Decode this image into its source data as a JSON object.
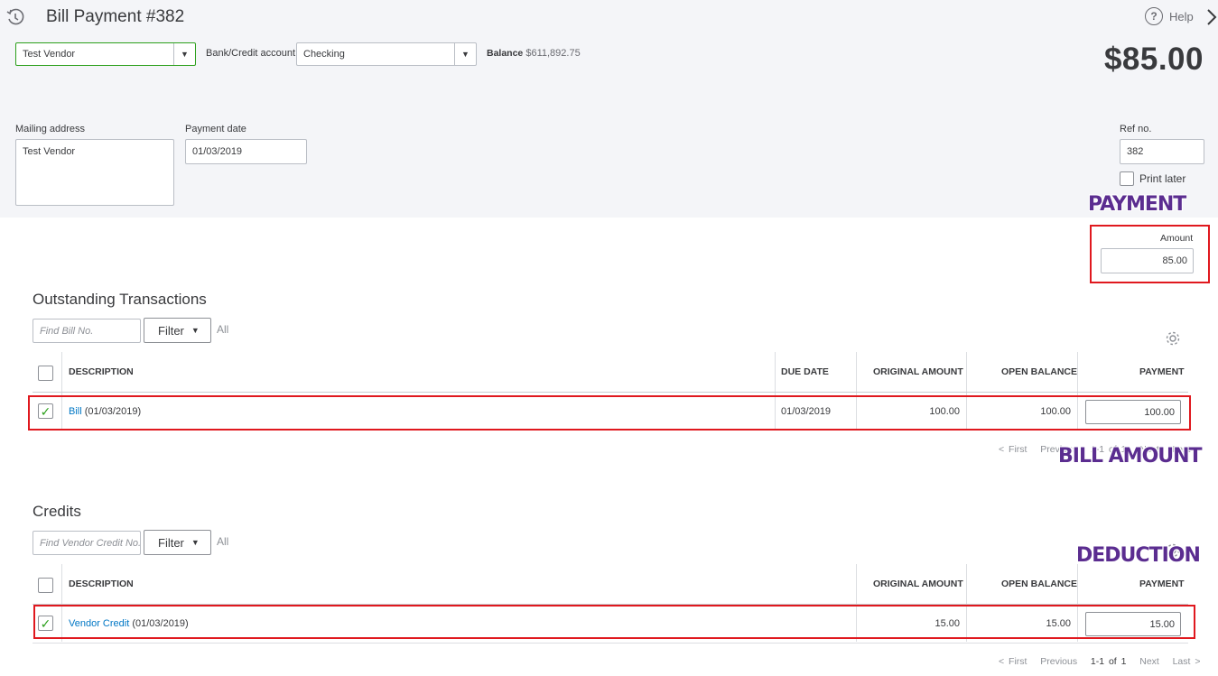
{
  "header": {
    "title": "Bill Payment #382",
    "help_label": "Help",
    "amount_display": "$85.00"
  },
  "form": {
    "vendor_value": "Test Vendor",
    "bank_label": "Bank/Credit account",
    "bank_value": "Checking",
    "balance_label": "Balance",
    "balance_value": "$611,892.75",
    "mailing_label": "Mailing address",
    "mailing_value": "Test Vendor",
    "payment_date_label": "Payment date",
    "payment_date_value": "01/03/2019",
    "ref_label": "Ref no.",
    "ref_value": "382",
    "print_later_label": "Print later",
    "amount_label": "Amount",
    "amount_value": "85.00"
  },
  "outstanding": {
    "title": "Outstanding Transactions",
    "search_placeholder": "Find Bill No.",
    "filter_label": "Filter",
    "all_label": "All",
    "columns": {
      "description": "DESCRIPTION",
      "due_date": "DUE DATE",
      "original_amount": "ORIGINAL AMOUNT",
      "open_balance": "OPEN BALANCE",
      "payment": "PAYMENT"
    },
    "rows": [
      {
        "link": "Bill",
        "desc_suffix": "(01/03/2019)",
        "due_date": "01/03/2019",
        "original_amount": "100.00",
        "open_balance": "100.00",
        "payment": "100.00",
        "checked": true
      }
    ],
    "pager": {
      "first": "< First",
      "previous": "Previous",
      "range": "1-1 of 1",
      "next": "Next",
      "last": "Last >"
    }
  },
  "credits": {
    "title": "Credits",
    "search_placeholder": "Find Vendor Credit No.",
    "filter_label": "Filter",
    "all_label": "All",
    "columns": {
      "description": "DESCRIPTION",
      "original_amount": "ORIGINAL AMOUNT",
      "open_balance": "OPEN BALANCE",
      "payment": "PAYMENT"
    },
    "rows": [
      {
        "link": "Vendor Credit",
        "desc_suffix": "(01/03/2019)",
        "original_amount": "15.00",
        "open_balance": "15.00",
        "payment": "15.00",
        "checked": true
      }
    ],
    "pager": {
      "first": "< First",
      "previous": "Previous",
      "range": "1-1 of 1",
      "next": "Next",
      "last": "Last >"
    }
  },
  "annotations": {
    "payment": "PAYMENT",
    "bill_amount": "BILL AMOUNT",
    "deduction": "DEDUCTION"
  },
  "icons": {
    "history": "history-clock-icon",
    "help": "question-circle-icon",
    "close": "chevron-right-icon",
    "settings": "gear-icon",
    "check": "checkmark-icon"
  },
  "colors": {
    "header_bg": "#f4f5f8",
    "link": "#0077c5",
    "check": "#2ca01c",
    "highlight_box": "#e0181e",
    "annotation": "#5b2d90"
  }
}
